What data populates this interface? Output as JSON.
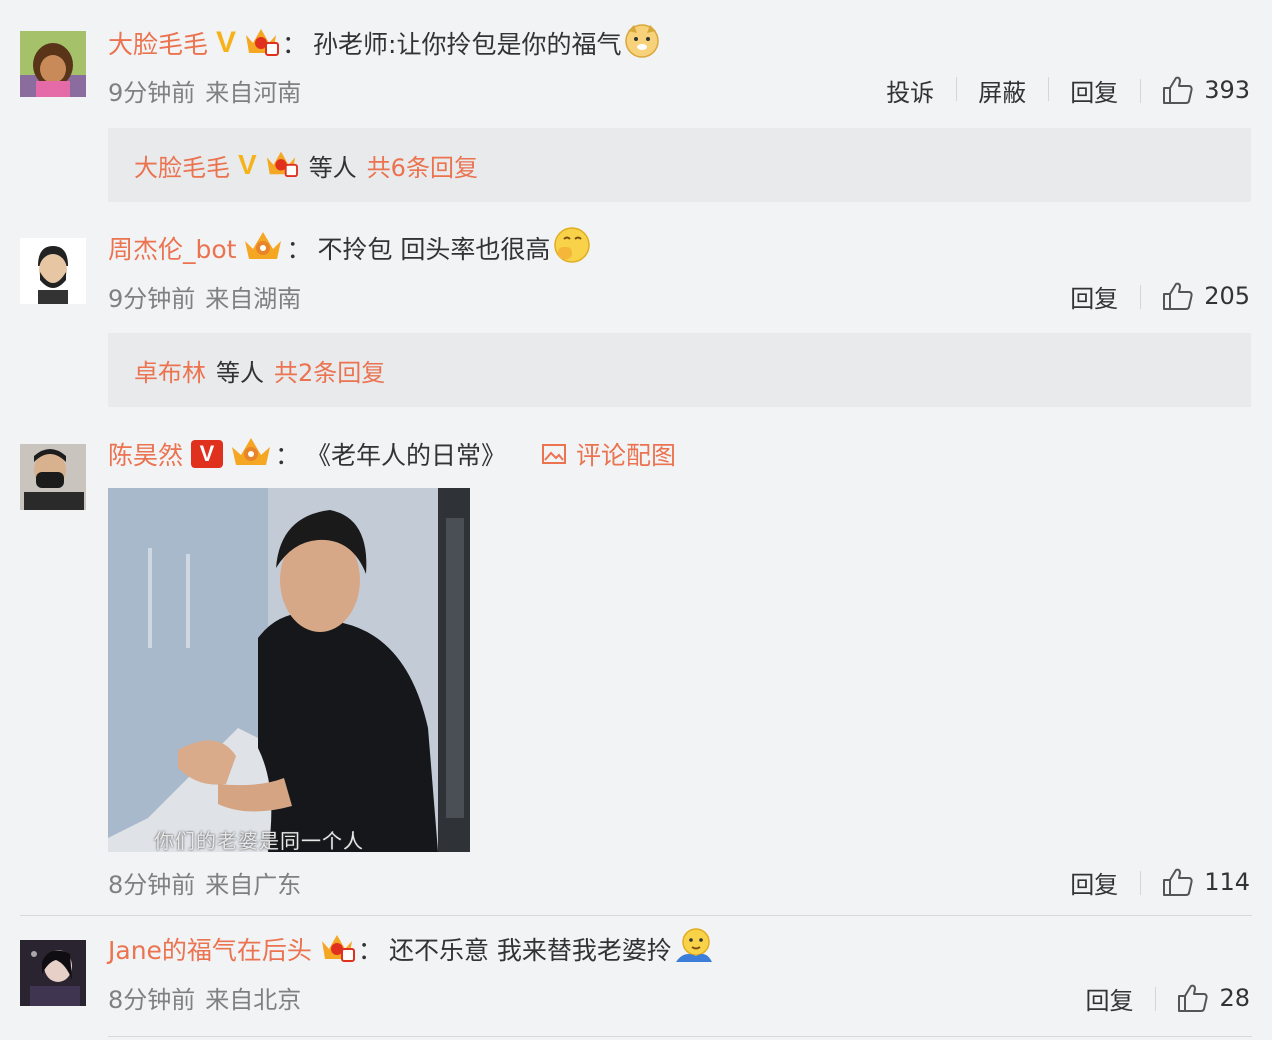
{
  "comments": [
    {
      "username": "大脸毛毛",
      "verified": "V",
      "text": "孙老师:让你拎包是你的福气",
      "time": "9分钟前",
      "location": "来自河南",
      "actions": {
        "report": "投诉",
        "block": "屏蔽",
        "reply": "回复"
      },
      "likes": "393",
      "reply_summary": {
        "name": "大脸毛毛",
        "verified": "V",
        "mid": "等人",
        "count": "共6条回复"
      }
    },
    {
      "username": "周杰伦_bot",
      "text": "不拎包 回头率也很高",
      "time": "9分钟前",
      "location": "来自湖南",
      "actions": {
        "reply": "回复"
      },
      "likes": "205",
      "reply_summary": {
        "name": "卓布林",
        "mid": "等人",
        "count": "共2条回复"
      }
    },
    {
      "username": "陈昊然",
      "verified": "V",
      "text": "《老年人的日常》",
      "picture_link": "评论配图",
      "image_caption": "你们的老婆是同一个人",
      "time": "8分钟前",
      "location": "来自广东",
      "actions": {
        "reply": "回复"
      },
      "likes": "114"
    },
    {
      "username": "Jane的福气在后头",
      "text": "还不乐意 我来替我老婆拎",
      "time": "8分钟前",
      "location": "来自北京",
      "actions": {
        "reply": "回复"
      },
      "likes": "28"
    }
  ],
  "colon": "：",
  "colors": {
    "username": "#eb7350",
    "text": "#333333",
    "meta": "#808080",
    "background": "#f2f3f5",
    "reply_box": "#e9eaec"
  },
  "icons": [
    "thumbs-up-icon",
    "crown-badge-icon",
    "image-icon",
    "emoji-icon"
  ]
}
